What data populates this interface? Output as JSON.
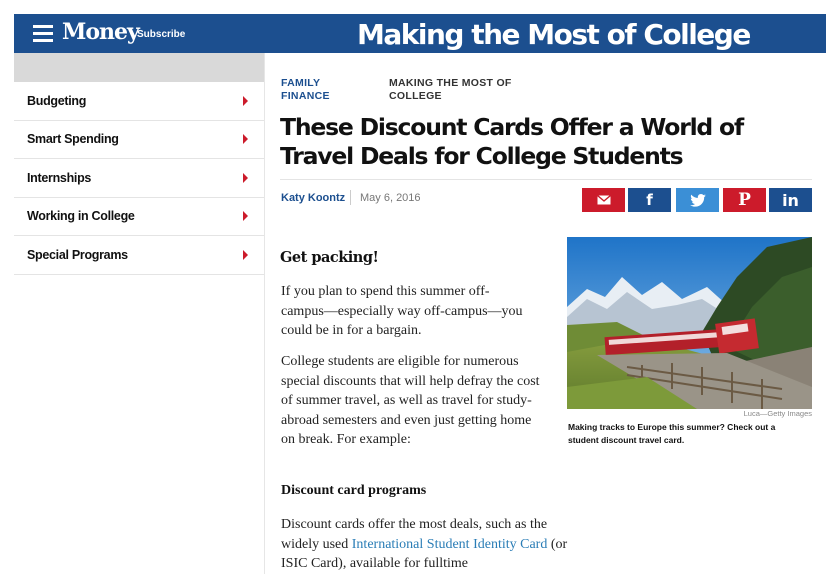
{
  "header": {
    "logo": "Money",
    "subscribe_label": "Subscribe",
    "section_title": "Making the Most of College",
    "brand_color": "#1c4f8f"
  },
  "sidebar": {
    "items": [
      {
        "label": "Budgeting"
      },
      {
        "label": "Smart Spending"
      },
      {
        "label": "Internships"
      },
      {
        "label": "Working in College"
      },
      {
        "label": "Special Programs"
      }
    ],
    "caret_color": "#cc1b2b"
  },
  "article": {
    "kicker_primary": "FAMILY FINANCE",
    "kicker_secondary": "MAKING THE MOST OF COLLEGE",
    "headline": "These Discount Cards Offer a World of Travel Deals for College Students",
    "author": "Katy Koontz",
    "date": "May 6, 2016",
    "share": [
      {
        "icon": "envelope-icon"
      },
      {
        "icon": "facebook-icon"
      },
      {
        "icon": "twitter-icon"
      },
      {
        "icon": "pinterest-icon"
      },
      {
        "icon": "linkedin-icon"
      }
    ],
    "subhead": "Get packing!",
    "paragraph1": "If you plan to spend this summer off-campus—especially way off-campus—you could be in for a bargain.",
    "paragraph2": "College students are eligible for numerous special discounts that will help defray the cost of summer travel, as well as travel for study-abroad semesters and even just getting home on break. For example:",
    "subhead2": "Discount card programs",
    "paragraph3_before": "Discount cards offer the most deals, such as the widely used ",
    "paragraph3_link": "International Student Identity Card",
    "paragraph3_after": " (or ISIC Card), available for fulltime",
    "image_credit": "Luca—Getty Images",
    "image_caption": "Making tracks to Europe this summer? Check out a student discount travel card."
  }
}
